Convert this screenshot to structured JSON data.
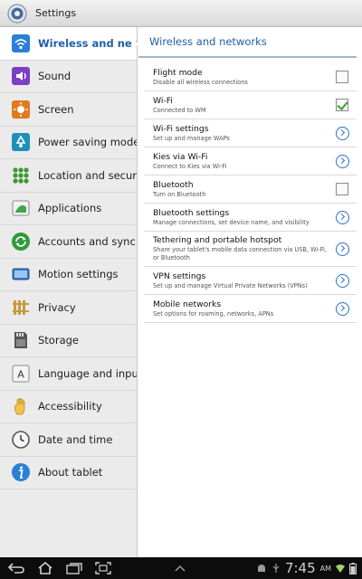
{
  "window": {
    "title": "Settings"
  },
  "sidebar": {
    "items": [
      {
        "label": "Wireless and networks",
        "icon": "wifi-icon",
        "selected": true
      },
      {
        "label": "Sound",
        "icon": "speaker-icon"
      },
      {
        "label": "Screen",
        "icon": "brightness-icon"
      },
      {
        "label": "Power saving mode",
        "icon": "recycle-icon"
      },
      {
        "label": "Location and security",
        "icon": "location-grid-icon"
      },
      {
        "label": "Applications",
        "icon": "applications-icon"
      },
      {
        "label": "Accounts and sync",
        "icon": "sync-icon"
      },
      {
        "label": "Motion settings",
        "icon": "motion-icon"
      },
      {
        "label": "Privacy",
        "icon": "privacy-icon"
      },
      {
        "label": "Storage",
        "icon": "storage-icon"
      },
      {
        "label": "Language and input",
        "icon": "keyboard-letter-icon"
      },
      {
        "label": "Accessibility",
        "icon": "hand-icon"
      },
      {
        "label": "Date and time",
        "icon": "clock-icon"
      },
      {
        "label": "About tablet",
        "icon": "info-icon"
      }
    ]
  },
  "main": {
    "header": "Wireless and networks",
    "rows": [
      {
        "title": "Flight mode",
        "subtitle": "Disable all wireless connections",
        "control": "checkbox",
        "checked": false
      },
      {
        "title": "Wi-Fi",
        "subtitle": "Connected to WM",
        "control": "checkbox",
        "checked": true
      },
      {
        "title": "Wi-Fi settings",
        "subtitle": "Set up and manage WAPs",
        "control": "chevron"
      },
      {
        "title": "Kies via Wi-Fi",
        "subtitle": "Connect to Kies via Wi-Fi",
        "control": "chevron"
      },
      {
        "title": "Bluetooth",
        "subtitle": "Turn on Bluetooth",
        "control": "checkbox",
        "checked": false
      },
      {
        "title": "Bluetooth settings",
        "subtitle": "Manage connections, set device name, and visibility",
        "control": "chevron"
      },
      {
        "title": "Tethering and portable hotspot",
        "subtitle": "Share your tablet's mobile data connection via USB, Wi-Fi, or Bluetooth",
        "control": "chevron"
      },
      {
        "title": "VPN settings",
        "subtitle": "Set up and manage Virtual Private Networks (VPNs)",
        "control": "chevron"
      },
      {
        "title": "Mobile networks",
        "subtitle": "Set options for roaming, networks, APNs",
        "control": "chevron"
      }
    ]
  },
  "status_bar": {
    "time": "7:45",
    "ampm": "AM"
  },
  "colors": {
    "accent": "#1f5fa8",
    "check": "#3aa32f",
    "chevron": "#2a6fc4"
  }
}
